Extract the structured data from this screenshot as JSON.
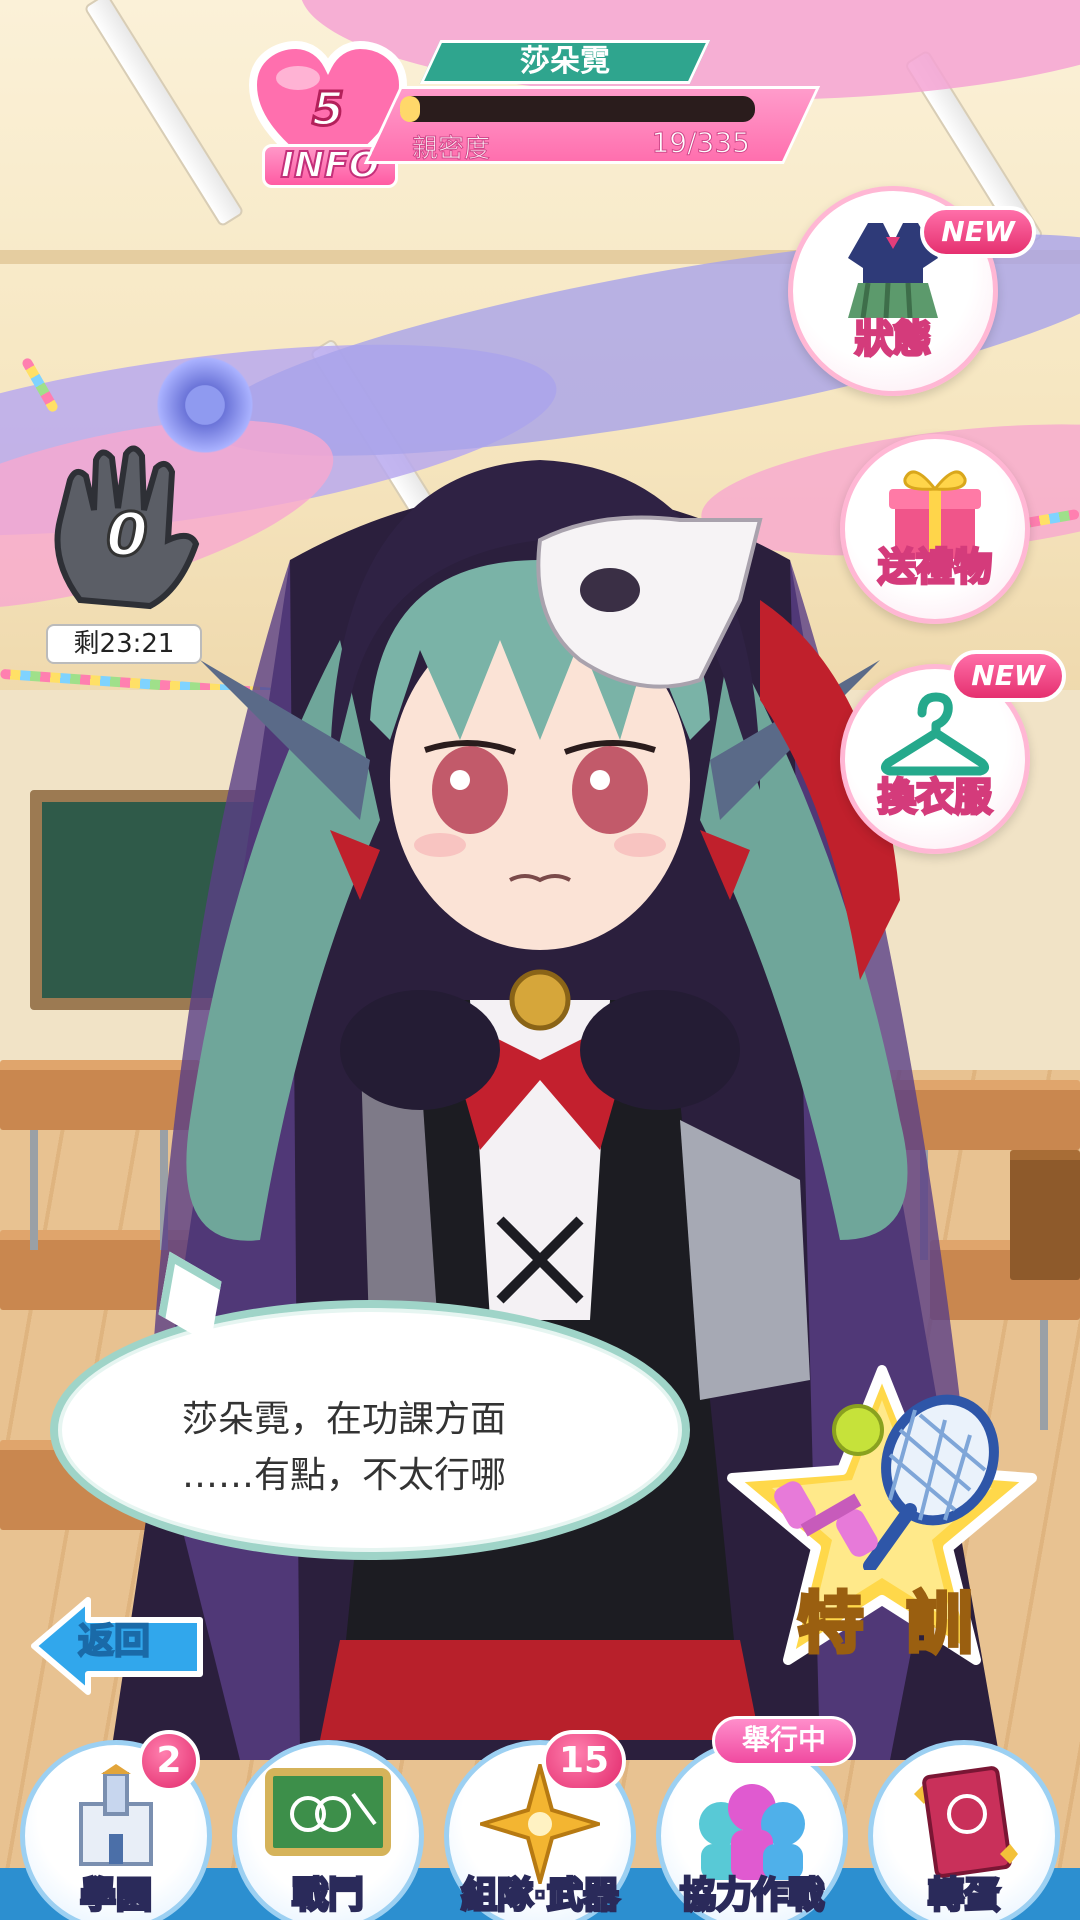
{
  "character": {
    "level": "5",
    "info_label": "INFO",
    "name": "莎朵霓",
    "bond_label": "親密度",
    "bond_value": "19/335",
    "bond_progress": 0.057
  },
  "stamina": {
    "count": "0",
    "timer": "剩23:21"
  },
  "side_menu": {
    "status": {
      "label": "狀態",
      "badge": "NEW",
      "icon": "uniform-icon"
    },
    "gift": {
      "label": "送禮物",
      "icon": "gift-box-icon"
    },
    "wardrobe": {
      "label": "換衣服",
      "badge": "NEW",
      "icon": "hanger-icon"
    }
  },
  "dialogue": {
    "line1": "莎朵霓，在功課方面",
    "line2": "……有點，不太行哪"
  },
  "special_training": {
    "label": "特 訓",
    "icon": "tennis-dumbbell-icon"
  },
  "back_button": {
    "label": "返回"
  },
  "bottom_nav": {
    "items": [
      {
        "label": "學園",
        "badge": "2",
        "icon": "academy-icon"
      },
      {
        "label": "戰鬥",
        "icon": "battle-board-icon"
      },
      {
        "label": "組隊·武器",
        "badge": "15",
        "icon": "star-weapon-icon"
      },
      {
        "label": "協力作戰",
        "badge": "舉行中",
        "icon": "coop-icon"
      },
      {
        "label": "轉蛋",
        "icon": "gacha-book-icon"
      }
    ]
  },
  "colors": {
    "accent_pink": "#ff5ba3",
    "name_teal": "#2fa58e",
    "nav_blue": "#2c8fd0"
  }
}
